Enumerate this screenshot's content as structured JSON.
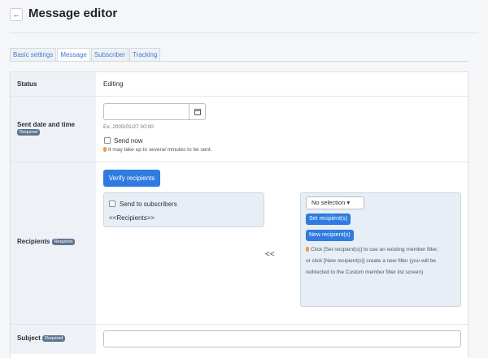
{
  "header": {
    "back_icon": "arrow-left-icon",
    "back_glyph": "←",
    "title": "Message editor"
  },
  "tabs": [
    {
      "label": "Basic settings",
      "active": false
    },
    {
      "label": "Message",
      "active": true
    },
    {
      "label": "Subscriber",
      "active": false
    },
    {
      "label": "Tracking",
      "active": false
    }
  ],
  "form": {
    "status": {
      "label": "Status",
      "value": "Editing"
    },
    "sent_date": {
      "label": "Sent date and time",
      "badge": "Required",
      "input_value": "",
      "calendar_icon": "calendar-icon",
      "example": "Ex. 2005/01/27 00:00",
      "send_now_label": "Send now",
      "send_now_checked": false,
      "note": "It may take up to several minutes to be sent."
    },
    "recipients": {
      "label": "Recipients",
      "badge": "Required",
      "verify_button": "Verify recipients",
      "send_to_subscribers_label": "Send to subscribers",
      "send_to_subscribers_checked": false,
      "recipients_placeholder": "<<Recipients>>",
      "move_arrows": "<<",
      "filter_select": "No selection ▾",
      "set_button": "Set recipient(s)",
      "new_button": "New recipient(s)",
      "help_line1": "Click [Set recipient(s)] to use an existing member filter,",
      "help_line2": "or click [New recipient(s)] create a new filter (you will be",
      "help_line3": "redirected to the Custom member filter list screen)."
    },
    "subject": {
      "label": "Subject",
      "badge": "Required",
      "value": ""
    }
  },
  "colors": {
    "primary": "#2f7be0",
    "label_bg": "#eef2f7",
    "badge_bg": "#5e7590",
    "note_icon": "#f29a4a"
  }
}
